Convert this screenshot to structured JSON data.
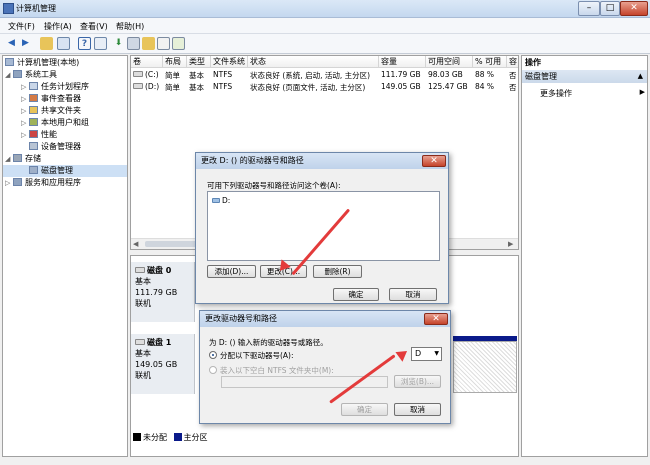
{
  "window": {
    "title": "计算机管理"
  },
  "menu": [
    "文件(F)",
    "操作(A)",
    "查看(V)",
    "帮助(H)"
  ],
  "tree": {
    "root": "计算机管理(本地)",
    "items": [
      {
        "label": "系统工具",
        "level": 1
      },
      {
        "label": "任务计划程序",
        "level": 2
      },
      {
        "label": "事件查看器",
        "level": 2
      },
      {
        "label": "共享文件夹",
        "level": 2
      },
      {
        "label": "本地用户和组",
        "level": 2
      },
      {
        "label": "性能",
        "level": 2
      },
      {
        "label": "设备管理器",
        "level": 2
      },
      {
        "label": "存储",
        "level": 1
      },
      {
        "label": "磁盘管理",
        "level": 2
      },
      {
        "label": "服务和应用程序",
        "level": 1
      }
    ]
  },
  "volumes": {
    "headers": [
      "卷",
      "布局",
      "类型",
      "文件系统",
      "状态",
      "容量",
      "可用空间",
      "% 可用",
      "容"
    ],
    "rows": [
      [
        "(C:)",
        "简单",
        "基本",
        "NTFS",
        "状态良好 (系统, 启动, 活动, 主分区)",
        "111.79 GB",
        "98.03 GB",
        "88 %",
        "否"
      ],
      [
        "(D:)",
        "简单",
        "基本",
        "NTFS",
        "状态良好 (页面文件, 活动, 主分区)",
        "149.05 GB",
        "125.47 GB",
        "84 %",
        "否"
      ]
    ]
  },
  "disks": [
    {
      "name": "磁盘 0",
      "type": "基本",
      "size": "111.79 GB",
      "status": "联机"
    },
    {
      "name": "磁盘 1",
      "type": "基本",
      "size": "149.05 GB",
      "status": "联机"
    }
  ],
  "legend": [
    {
      "label": "未分配",
      "color": "#000000"
    },
    {
      "label": "主分区",
      "color": "#0a1a8a"
    }
  ],
  "actions": {
    "header": "操作",
    "section": "磁盘管理",
    "more": "更多操作"
  },
  "dialog1": {
    "title": "更改 D: () 的驱动器号和路径",
    "prompt": "可用下列驱动器号和路径访问这个卷(A):",
    "entry": "D:",
    "add": "添加(D)...",
    "change": "更改(C)...",
    "remove": "删除(R)",
    "ok": "确定",
    "cancel": "取消"
  },
  "dialog2": {
    "title": "更改驱动器号和路径",
    "prompt": "为 D: () 输入新的驱动器号或路径。",
    "option_letter": "分配以下驱动器号(A):",
    "option_path": "装入以下空白 NTFS 文件夹中(M):",
    "letter": "D",
    "browse": "浏览(B)...",
    "ok": "确定",
    "cancel": "取消"
  },
  "colors": {
    "accent_arrow": "#e33b3b",
    "primary_partition": "#0a1a8a"
  }
}
